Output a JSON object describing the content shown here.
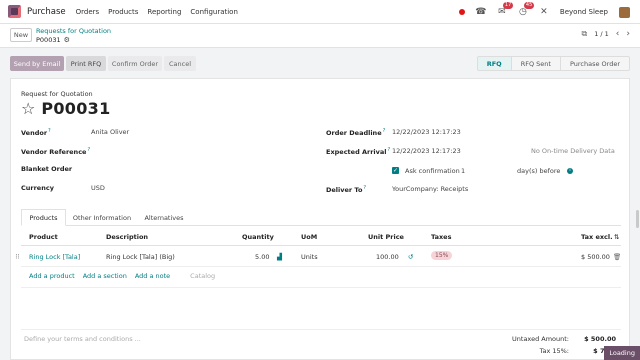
{
  "navbar": {
    "app_name": "Purchase",
    "menu": [
      "Orders",
      "Products",
      "Reporting",
      "Configuration"
    ],
    "chat_badge": "17",
    "activity_badge": "45",
    "company": "Beyond Sleep"
  },
  "control": {
    "new_label": "New",
    "breadcrumb_parent": "Requests for Quotation",
    "breadcrumb_current": "P00031",
    "pager": "1 / 1"
  },
  "actions": {
    "send_email": "Send by Email",
    "print_rfq": "Print RFQ",
    "confirm_order": "Confirm Order",
    "cancel": "Cancel"
  },
  "stages": [
    "RFQ",
    "RFQ Sent",
    "Purchase Order"
  ],
  "stage_active": "RFQ",
  "form": {
    "doc_type": "Request for Quotation",
    "doc_ref": "P00031",
    "vendor_label": "Vendor",
    "vendor_value": "Anita Oliver",
    "vendor_ref_label": "Vendor Reference",
    "blanket_label": "Blanket Order",
    "currency_label": "Currency",
    "currency_value": "USD",
    "deadline_label": "Order Deadline",
    "deadline_value": "12/22/2023 12:17:23",
    "arrival_label": "Expected Arrival",
    "arrival_value": "12/22/2023 12:17:23",
    "ontime_note": "No On-time Delivery Data",
    "ask_confirm_label": "Ask confirmation",
    "ask_confirm_days": "1",
    "days_before": "day(s) before",
    "deliver_label": "Deliver To",
    "deliver_value": "YourCompany: Receipts",
    "help_mark": "?"
  },
  "tabs": [
    "Products",
    "Other Information",
    "Alternatives"
  ],
  "table": {
    "headers": {
      "product": "Product",
      "description": "Description",
      "quantity": "Quantity",
      "uom": "UoM",
      "unit_price": "Unit Price",
      "taxes": "Taxes",
      "tax_excl": "Tax excl."
    },
    "rows": [
      {
        "product": "Ring Lock [Tala]",
        "description": "Ring Lock [Tala] (Big)",
        "quantity": "5.00",
        "uom": "Units",
        "unit_price": "100.00",
        "tax": "15%",
        "subtotal": "$ 500.00"
      }
    ],
    "add_product": "Add a product",
    "add_section": "Add a section",
    "add_note": "Add a note",
    "catalog": "Catalog"
  },
  "footer": {
    "terms_placeholder": "Define your terms and conditions ...",
    "untaxed_label": "Untaxed Amount:",
    "untaxed_value": "$ 500.00",
    "tax_label": "Tax 15%:",
    "tax_value": "$ 75.0"
  },
  "loading": "Loading"
}
